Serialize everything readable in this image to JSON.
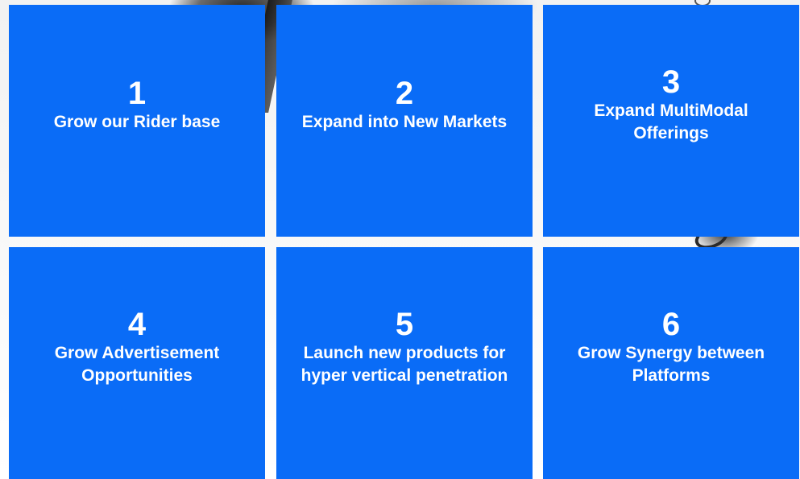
{
  "colors": {
    "tile_background": "#0a6cf7",
    "tile_text": "#ffffff",
    "page_background": "#ffffff"
  },
  "tiles": [
    {
      "number": "1",
      "label": "Grow our Rider base"
    },
    {
      "number": "2",
      "label": "Expand into New Markets"
    },
    {
      "number": "3",
      "label": "Expand MultiModal Offerings"
    },
    {
      "number": "4",
      "label": "Grow Advertisement Opportunities"
    },
    {
      "number": "5",
      "label": "Launch new products for hyper vertical penetration"
    },
    {
      "number": "6",
      "label": "Grow Synergy between Platforms"
    }
  ]
}
